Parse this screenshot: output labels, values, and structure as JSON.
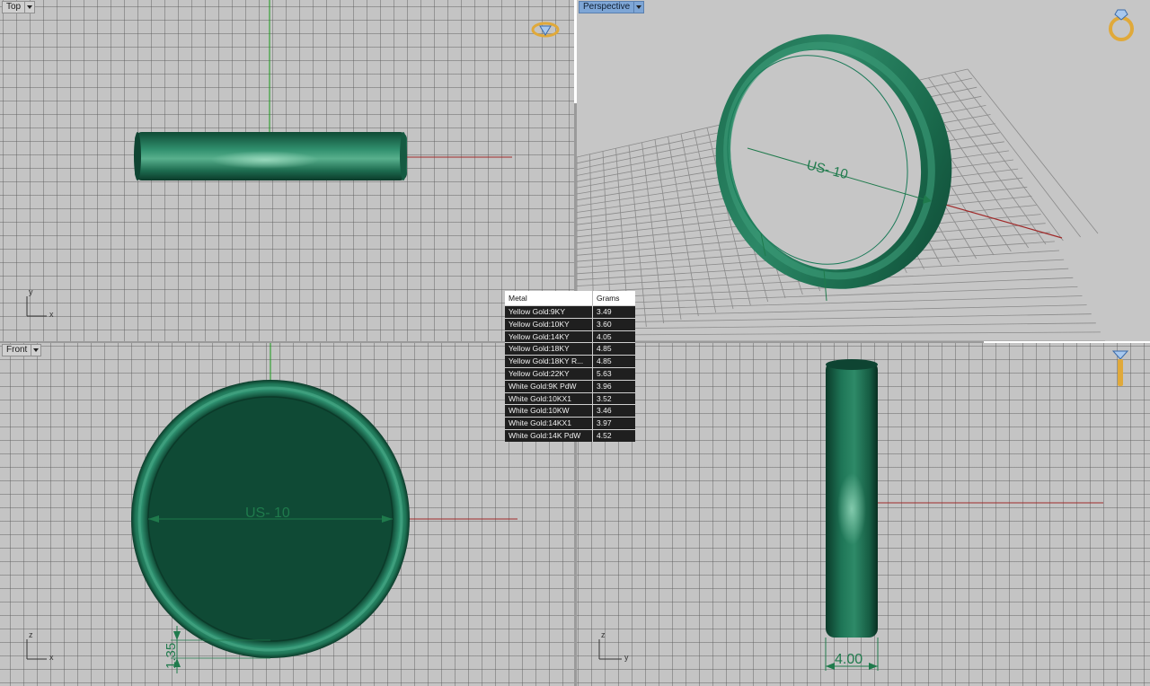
{
  "viewports": {
    "top": {
      "label": "Top",
      "axis_x": "x",
      "axis_y": "y"
    },
    "perspective": {
      "label": "Perspective",
      "size_label": "US- 10"
    },
    "front": {
      "label": "Front",
      "size_label": "US- 10",
      "thickness_label": "1.35",
      "axis_x": "x",
      "axis_z": "z"
    },
    "right": {
      "width_label": "4.00",
      "axis_y": "y",
      "axis_z": "z"
    }
  },
  "icons": {
    "top": "diamond-ring-icon",
    "perspective": "gold-ring-icon",
    "right": "ring-side-icon"
  },
  "colors": {
    "ring": "#1e7a58",
    "dimension": "#1f7a4c",
    "x_axis": "#a02a2a",
    "y_axis": "#1a9a1a",
    "gold": "#e0a93a"
  },
  "metal_table": {
    "headers": [
      "Metal",
      "Grams"
    ],
    "rows": [
      [
        "Yellow Gold:9KY",
        "3.49"
      ],
      [
        "Yellow Gold:10KY",
        "3.60"
      ],
      [
        "Yellow Gold:14KY",
        "4.05"
      ],
      [
        "Yellow Gold:18KY",
        "4.85"
      ],
      [
        "Yellow Gold:18KY R...",
        "4.85"
      ],
      [
        "Yellow Gold:22KY",
        "5.63"
      ],
      [
        "White Gold:9K PdW",
        "3.96"
      ],
      [
        "White Gold:10KX1",
        "3.52"
      ],
      [
        "White Gold:10KW",
        "3.46"
      ],
      [
        "White Gold:14KX1",
        "3.97"
      ],
      [
        "White Gold:14K PdW",
        "4.52"
      ]
    ]
  }
}
